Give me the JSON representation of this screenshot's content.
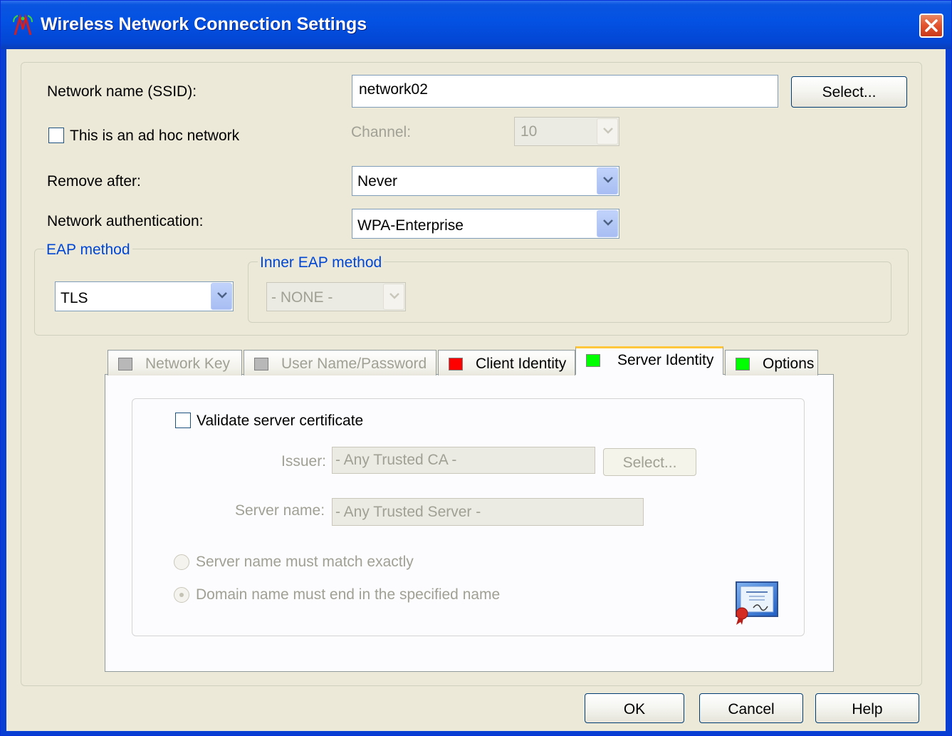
{
  "window": {
    "title": "Wireless Network Connection Settings"
  },
  "form": {
    "ssid_label": "Network name (SSID):",
    "ssid_value": "network02",
    "select_button": "Select...",
    "adhoc_label": "This is an ad hoc network",
    "adhoc_checked": false,
    "channel_label": "Channel:",
    "channel_value": "10",
    "remove_after_label": "Remove after:",
    "remove_after_value": "Never",
    "auth_label": "Network authentication:",
    "auth_value": "WPA-Enterprise"
  },
  "eap": {
    "group_label": "EAP method",
    "method_value": "TLS",
    "inner_group_label": "Inner EAP method",
    "inner_value": "- NONE -"
  },
  "tabs": [
    {
      "label": "Network Key",
      "status_color": "#b8b8b8",
      "enabled": false
    },
    {
      "label": "User Name/Password",
      "status_color": "#b8b8b8",
      "enabled": false
    },
    {
      "label": "Client Identity",
      "status_color": "#ff0000",
      "enabled": true
    },
    {
      "label": "Server Identity",
      "status_color": "#00ff00",
      "enabled": true,
      "active": true
    },
    {
      "label": "Options",
      "status_color": "#00ff00",
      "enabled": true
    }
  ],
  "server_identity": {
    "validate_label": "Validate server certificate",
    "validate_checked": false,
    "issuer_label": "Issuer:",
    "issuer_value": "- Any Trusted CA -",
    "issuer_select": "Select...",
    "server_name_label": "Server name:",
    "server_name_value": "- Any Trusted Server -",
    "radio_exact": "Server name must match exactly",
    "radio_domain": "Domain name must end in the specified name",
    "selected_radio": "domain",
    "certificate_icon": "certificate-icon"
  },
  "footer": {
    "ok": "OK",
    "cancel": "Cancel",
    "help": "Help"
  },
  "colors": {
    "titlebar": "#0452e3",
    "dialog_bg": "#ece9d8",
    "group_label": "#0046d5",
    "disabled_text": "#a0a094"
  }
}
